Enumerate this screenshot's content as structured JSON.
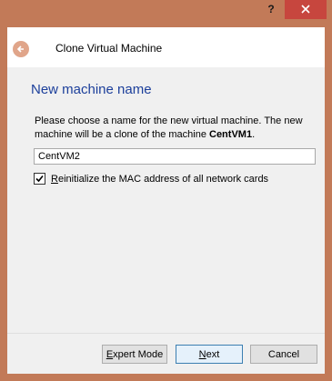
{
  "window": {
    "help_label": "?",
    "close_icon": "close-icon"
  },
  "wizard": {
    "title": "Clone Virtual Machine",
    "back_icon": "back-arrow-icon"
  },
  "page": {
    "heading": "New machine name",
    "description_prefix": "Please choose a name for the new virtual machine. The new machine will be a clone of the machine ",
    "source_machine": "CentVM1",
    "description_suffix": ".",
    "name_value": "CentVM2",
    "mac_checkbox_checked": true,
    "mac_label_accel": "R",
    "mac_label_rest": "einitialize the MAC address of all network cards"
  },
  "buttons": {
    "expert_accel": "E",
    "expert_rest": "xpert Mode",
    "next_accel": "N",
    "next_rest": "ext",
    "cancel": "Cancel"
  },
  "colors": {
    "frame": "#c27a58",
    "close_button": "#c7463e",
    "heading": "#1c3f9b"
  }
}
